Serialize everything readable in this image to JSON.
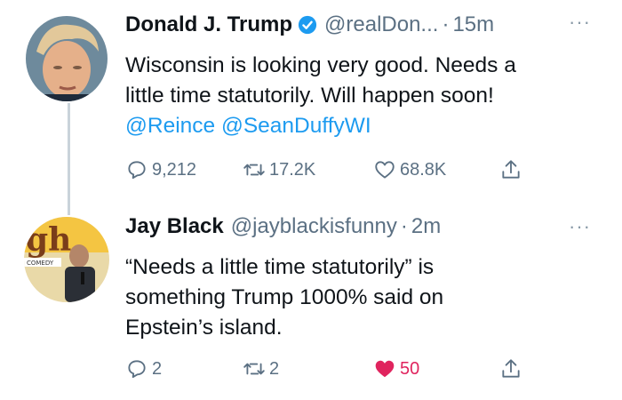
{
  "tweets": [
    {
      "author_name": "Donald J. Trump",
      "handle": "@realDon...",
      "time": "15m",
      "more": "···",
      "lines": [
        "Wisconsin is looking very good. Needs a",
        "little time statutorily. Will happen soon!"
      ],
      "mentions": [
        "@Reince",
        "@SeanDuffyWI"
      ],
      "replies": "9,212",
      "retweets": "17.2K",
      "likes": "68.8K"
    },
    {
      "author_name": "Jay Black",
      "handle": "@jayblackisfunny",
      "time": "2m",
      "more": "···",
      "lines": [
        "“Needs a little time statutorily” is",
        "something Trump 1000% said on",
        "Epstein’s island."
      ],
      "replies": "2",
      "retweets": "2",
      "likes": "50",
      "avatar_text": "gh",
      "avatar_banner": "COMEDY"
    }
  ],
  "separator": "·",
  "colors": {
    "link": "#1d9bf0",
    "muted": "#5b7083",
    "like": "#e0245e",
    "text": "#0f1419"
  }
}
